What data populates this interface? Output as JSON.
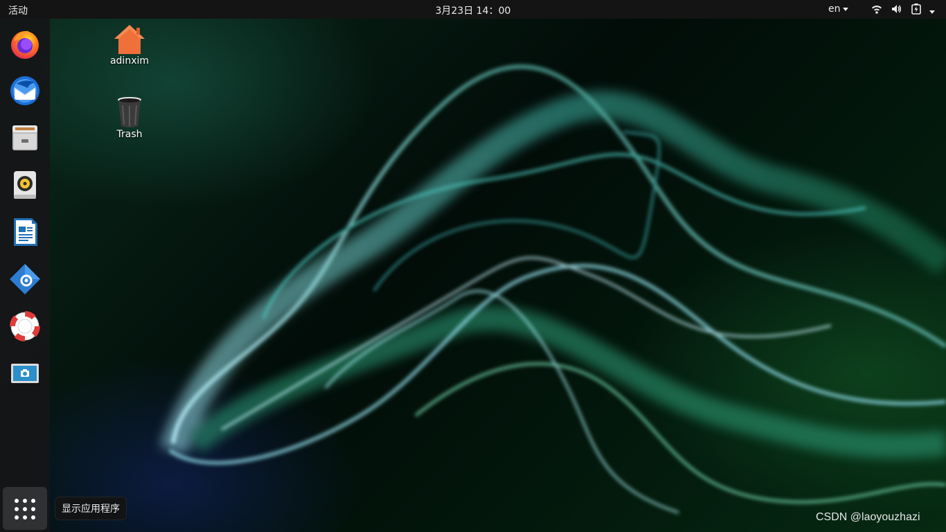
{
  "topbar": {
    "activities": "活动",
    "clock": "3月23日  14：00",
    "language": "en"
  },
  "dock": {
    "items": [
      {
        "name": "Firefox",
        "icon": "firefox-icon"
      },
      {
        "name": "Thunderbird",
        "icon": "thunderbird-icon"
      },
      {
        "name": "Files",
        "icon": "files-icon"
      },
      {
        "name": "Rhythmbox",
        "icon": "rhythmbox-icon"
      },
      {
        "name": "LibreOffice Writer",
        "icon": "writer-icon"
      },
      {
        "name": "Software",
        "icon": "software-icon"
      },
      {
        "name": "Help",
        "icon": "help-icon"
      },
      {
        "name": "Screenshot",
        "icon": "screenshot-icon"
      }
    ],
    "show_apps_tooltip": "显示应用程序"
  },
  "desktop": {
    "icons": [
      {
        "label": "adinxim",
        "icon": "home-folder-icon"
      },
      {
        "label": "Trash",
        "icon": "trash-icon"
      }
    ]
  },
  "watermark": "CSDN @laoyouzhazi",
  "colors": {
    "topbar": "#141414",
    "dock": "#161618",
    "accent_orange": "#e95420"
  }
}
